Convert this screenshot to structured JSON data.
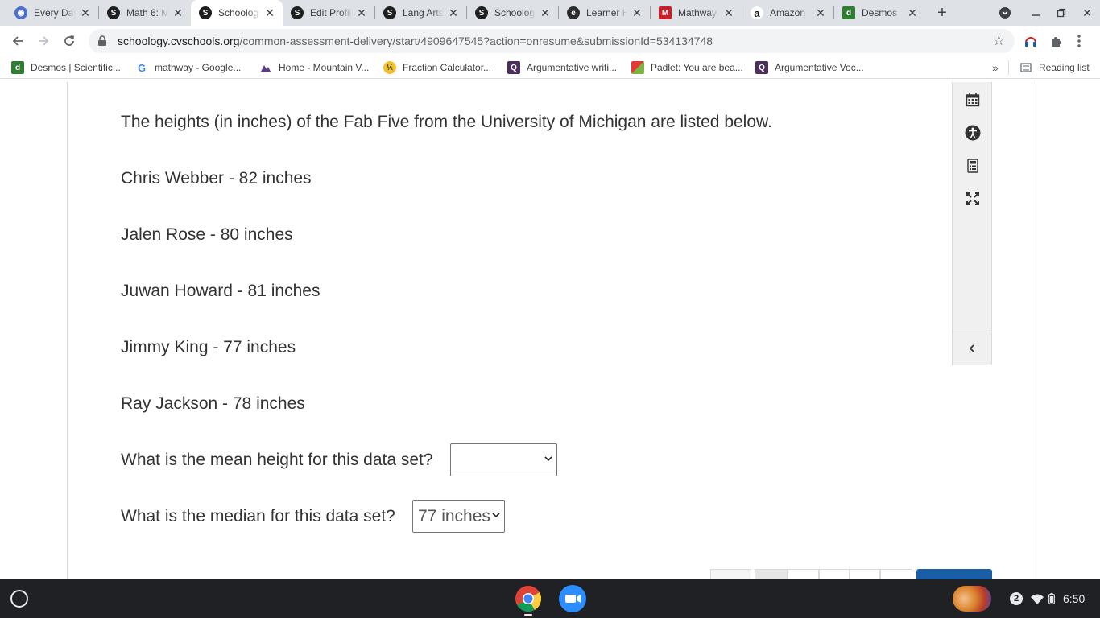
{
  "tabs": [
    {
      "title": "Every Day"
    },
    {
      "title": "Math 6: M"
    },
    {
      "title": "Schoology"
    },
    {
      "title": "Edit Profil"
    },
    {
      "title": "Lang Arts"
    },
    {
      "title": "Schoology"
    },
    {
      "title": "Learner H"
    },
    {
      "title": "Mathway"
    },
    {
      "title": "Amazon"
    },
    {
      "title": "Desmos"
    }
  ],
  "address": {
    "host": "schoology.cvschools.org",
    "path": "/common-assessment-delivery/start/4909647545?action=onresume&submissionId=534134748"
  },
  "bookmarks": [
    {
      "label": "Desmos | Scientific..."
    },
    {
      "label": "mathway - Google..."
    },
    {
      "label": "Home - Mountain V..."
    },
    {
      "label": "Fraction Calculator..."
    },
    {
      "label": "Argumentative writi..."
    },
    {
      "label": "Padlet: You are bea..."
    },
    {
      "label": "Argumentative Voc..."
    }
  ],
  "reading_list": "Reading list",
  "question": {
    "intro": "The heights (in inches) of the Fab Five from the University of Michigan are listed below.",
    "players": [
      "Chris Webber - 82 inches",
      "Jalen Rose - 80 inches",
      "Juwan Howard - 81 inches",
      "Jimmy King - 77 inches",
      "Ray Jackson - 78 inches"
    ],
    "mean_prompt": "What is the mean height for this data set?",
    "mean_value": "",
    "median_prompt": "What is the median for this data set?",
    "median_value": "77 inches"
  },
  "shelf": {
    "notification_count": "2",
    "time": "6:50"
  },
  "colors": {
    "tabstrip": "#dee1e6",
    "text": "#333333",
    "next_button": "#1a5fa6",
    "shelf": "#202124"
  }
}
